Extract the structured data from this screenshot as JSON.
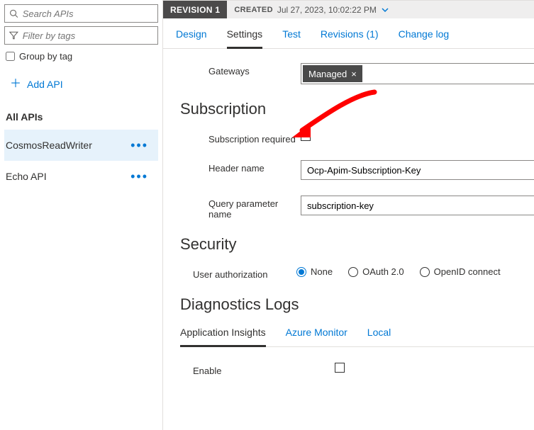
{
  "sidebar": {
    "search_placeholder": "Search APIs",
    "filter_placeholder": "Filter by tags",
    "group_label": "Group by tag",
    "add_api": "Add API",
    "all_apis": "All APIs",
    "items": [
      {
        "label": "CosmosReadWriter",
        "selected": true
      },
      {
        "label": "Echo API",
        "selected": false
      }
    ]
  },
  "revision": {
    "badge": "REVISION 1",
    "created_label": "CREATED",
    "created_value": "Jul 27, 2023, 10:02:22 PM"
  },
  "tabs": [
    "Design",
    "Settings",
    "Test",
    "Revisions (1)",
    "Change log"
  ],
  "active_tab": "Settings",
  "gateways": {
    "label": "Gateways",
    "chips": [
      "Managed"
    ]
  },
  "subscription": {
    "title": "Subscription",
    "required_label": "Subscription required",
    "required_checked": false,
    "header_label": "Header name",
    "header_value": "Ocp-Apim-Subscription-Key",
    "query_label": "Query parameter name",
    "query_value": "subscription-key"
  },
  "security": {
    "title": "Security",
    "auth_label": "User authorization",
    "options": [
      "None",
      "OAuth 2.0",
      "OpenID connect"
    ],
    "selected": "None"
  },
  "diagnostics": {
    "title": "Diagnostics Logs",
    "subtabs": [
      "Application Insights",
      "Azure Monitor",
      "Local"
    ],
    "active_subtab": "Application Insights",
    "enable_label": "Enable",
    "enable_checked": false
  }
}
